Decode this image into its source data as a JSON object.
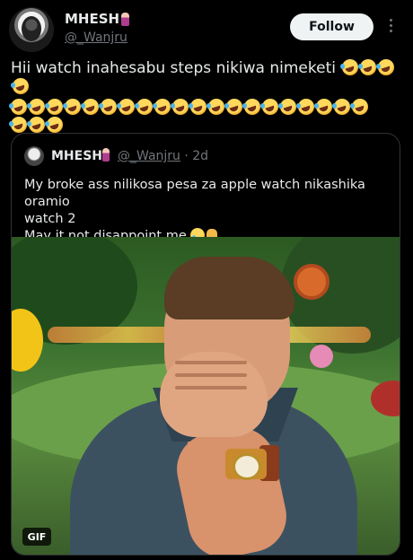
{
  "post": {
    "display_name": "MHESH",
    "handle": "@_Wanjru",
    "follow_label": "Follow",
    "text": "Hii watch inahesabu steps nikiwa nimeketi",
    "emoji_trailing_count": 4,
    "emoji_row2_count": 20,
    "emoji_row3_count": 3,
    "emoji_name": "rolling-on-the-floor-laughing"
  },
  "quoted": {
    "display_name": "MHESH",
    "handle": "@_Wanjru",
    "time_ago": "· 2d",
    "text_line1": "My broke ass nilikosa pesa za apple watch nikashika oramio",
    "text_line2": "watch 2",
    "text_line3": "May it not disappoint me",
    "media_badge": "GIF"
  }
}
